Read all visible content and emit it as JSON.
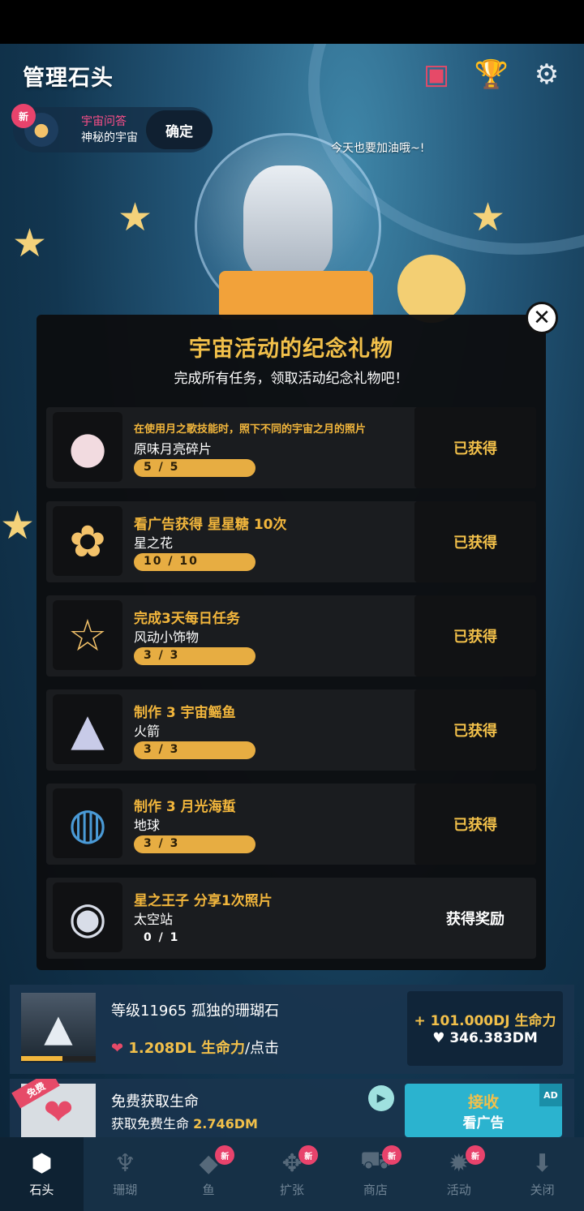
{
  "header": {
    "title": "管理石头",
    "icons": [
      "photo-album-icon",
      "trophy-icon",
      "gear-icon"
    ]
  },
  "notification": {
    "badge": "新",
    "line1": "宇宙问答",
    "line2": "神秘的宇宙",
    "confirm_label": "确定"
  },
  "speech_bubble": "今天也要加油哦~!",
  "modal": {
    "title": "宇宙活动的纪念礼物",
    "subtitle": "完成所有任务，领取活动纪念礼物吧！",
    "rows": [
      {
        "task": "在使用月之歌技能时，照下不同的宇宙之月的照片",
        "name": "原味月亮碎片",
        "progress": "5 / 5",
        "progress_fraction": 1,
        "status": "已获得",
        "icon": "moon-piece-icon"
      },
      {
        "task": "看广告获得 星星糖  10次",
        "name": "星之花",
        "progress": "10 / 10",
        "progress_fraction": 1,
        "status": "已获得",
        "icon": "star-flower-icon"
      },
      {
        "task": "完成3天每日任务",
        "name": "风动小饰物",
        "progress": "3 / 3",
        "progress_fraction": 1,
        "status": "已获得",
        "icon": "wind-chime-icon"
      },
      {
        "task": "制作 3 宇宙鳐鱼",
        "name": "火箭",
        "progress": "3 / 3",
        "progress_fraction": 1,
        "status": "已获得",
        "icon": "rocket-icon"
      },
      {
        "task": "制作 3 月光海蜇",
        "name": "地球",
        "progress": "3 / 3",
        "progress_fraction": 1,
        "status": "已获得",
        "icon": "earth-icon"
      },
      {
        "task": "星之王子 分享1次照片",
        "name": "太空站",
        "progress": "0 / 1",
        "progress_fraction": 0,
        "status": "获得奖励",
        "icon": "space-station-icon"
      }
    ]
  },
  "stone_info": {
    "level": "等级11965 孤独的珊瑚石",
    "tap_value": "1.208DL 生命力",
    "tap_suffix": "/点击",
    "income": "+ 101.000DJ 生命力",
    "total": "♥ 346.383DM",
    "exp_fraction": 0.55
  },
  "ad_offer": {
    "ribbon": "免费",
    "title": "免费获取生命",
    "sub_label": "获取免费生命",
    "sub_value": "2.746DM",
    "button_line1": "接收",
    "button_line2": "看广告",
    "tag": "AD"
  },
  "tabs": [
    {
      "label": "石头",
      "badge": "",
      "active": true
    },
    {
      "label": "珊瑚",
      "badge": ""
    },
    {
      "label": "鱼",
      "badge": "新"
    },
    {
      "label": "扩张",
      "badge": "新"
    },
    {
      "label": "商店",
      "badge": "新"
    },
    {
      "label": "活动",
      "badge": "新"
    },
    {
      "label": "关闭",
      "badge": ""
    }
  ],
  "colors": {
    "accent": "#f2c04a",
    "badge": "#e8436c",
    "button": "#2bb3cf"
  }
}
